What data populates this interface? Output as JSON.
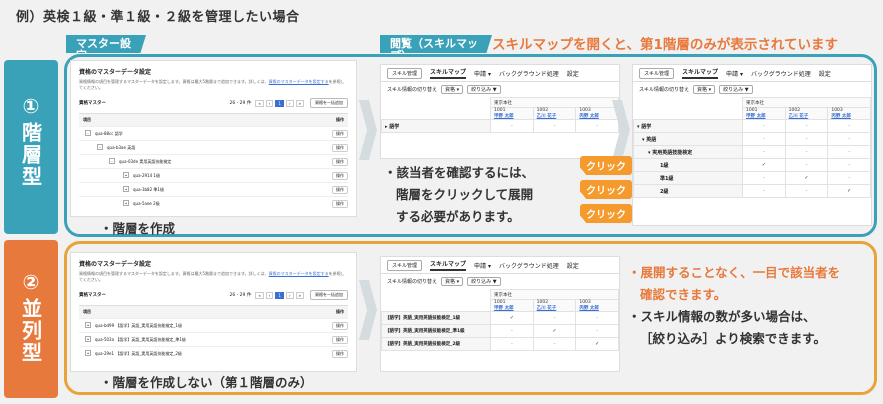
{
  "title": "例）英検１級・準１級・２級を管理したい場合",
  "ribbon_master": "マスター設定",
  "ribbon_view": "閲覧（スキルマップ）",
  "hint": "スキルマップを開くと、第1階層のみが表示されています",
  "side1": {
    "num": "①",
    "label": "階層型"
  },
  "side2": {
    "num": "②",
    "label": "並列型"
  },
  "master": {
    "title": "資格のマスターデータ設定",
    "desc": "資格情報の項目を管理するマスターデータを設定します。資格は最大5階層まで追加できます。詳しくは、",
    "desc_link": "資格のマスターデータを設定する",
    "desc_end": "を参照してください。",
    "label": "資格マスター",
    "range": "26 - 29 件",
    "pages": [
      "«",
      "‹",
      "1",
      "›",
      "»"
    ],
    "bulk": "資格を一括追加",
    "col_item": "項目",
    "col_op": "操作",
    "op": "操作",
    "rows1": [
      "qua-88cc 語学",
      "qua-b3ae 英語",
      "qua-03de 実用英語技能検定",
      "qua-2914 1級",
      "qua-3b82 準1級",
      "qua-5aee 2級"
    ],
    "rows2": [
      "qua-bd99 【語学】英語_実用英語技能検定_1級",
      "qua-503a 【語学】英語_実用英語技能検定_準1級",
      "qua-29e1 【語学】英語_実用英語技能検定_2級"
    ]
  },
  "cap1": "・階層を作成",
  "cap2": "・階層を作成しない（第１階層のみ）",
  "skill": {
    "tab_manage": "スキル管理",
    "tab_map": "スキルマップ",
    "tab_apply": "申請",
    "tab_bg": "バックグラウンド処理",
    "tab_setting": "設定",
    "switch": "スキル情報の切り替え",
    "qual": "資格",
    "filter": "絞り込み",
    "dept": "東京本社",
    "emps": [
      {
        "id": "1001",
        "name": "甲野 太郎"
      },
      {
        "id": "1002",
        "name": "乙川 花子"
      },
      {
        "id": "1003",
        "name": "丙野 太郎"
      }
    ],
    "lang": "語学",
    "eng": "英語",
    "eiken": "実用英語技能検定",
    "g1": "1級",
    "gp1": "準1級",
    "g2": "2級",
    "r1": "【語学】英語_実用英語技能検定_1級",
    "r2": "【語学】英語_実用英語技能検定_準1級",
    "r3": "【語学】英語_実用英語技能検定_2級",
    "dash": "-",
    "check": "✓"
  },
  "click": "クリック",
  "mid1": [
    "・該当者を確認するには、",
    "階層をクリックして展開",
    "する必要があります。"
  ],
  "mid2": [
    "・展開することなく、一目で該当者を",
    "確認できます。",
    "・スキル情報の数が多い場合は、",
    "［絞り込み］より検索できます。"
  ]
}
